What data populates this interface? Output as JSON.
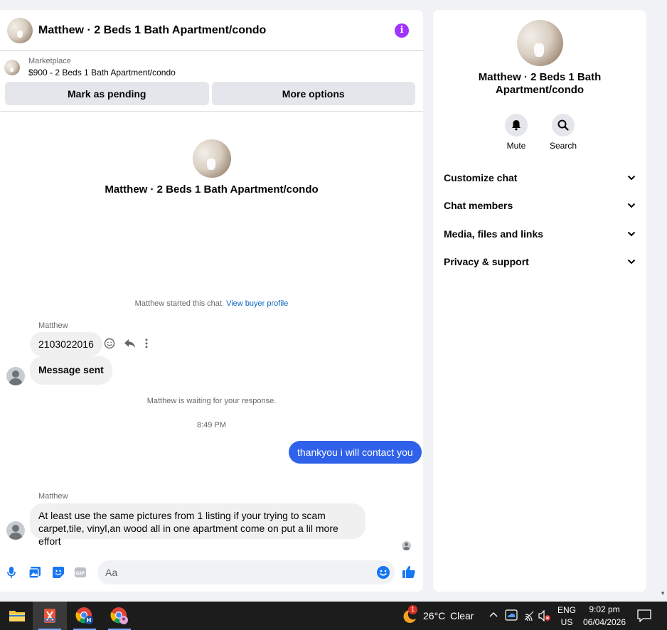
{
  "header": {
    "title": "Matthew · 2 Beds 1 Bath Apartment/condo",
    "info_icon": "info-icon"
  },
  "marketplace": {
    "label": "Marketplace",
    "listing": "$900 - 2 Beds 1 Bath Apartment/condo"
  },
  "actions": {
    "mark_pending": "Mark as pending",
    "more_options": "More options"
  },
  "profile": {
    "name": "Matthew · 2 Beds 1 Bath Apartment/condo"
  },
  "system": {
    "started_prefix": "Matthew started this chat.",
    "view_profile": "View buyer profile",
    "waiting": "Matthew is waiting for your response.",
    "timestamp": "8:49 PM"
  },
  "messages": {
    "sender1": "Matthew",
    "msg1": "2103022016",
    "msg2": "Message sent",
    "outgoing": "thankyou i will contact you",
    "sender2": "Matthew",
    "msg3_line1": "At least use the same pictures from 1 listing if your trying to scam",
    "msg3_line2": "carpet,tile, vinyl,an wood all in one apartment come on put a lil more effort"
  },
  "composer": {
    "placeholder": "Aa"
  },
  "info_panel": {
    "name_line1": "Matthew · 2 Beds 1 Bath",
    "name_line2": "Apartment/condo",
    "mute": "Mute",
    "search": "Search",
    "sections": [
      "Customize chat",
      "Chat members",
      "Media, files and links",
      "Privacy & support"
    ]
  },
  "taskbar": {
    "weather_temp": "26°C",
    "weather_cond": "Clear",
    "weather_badge": "1",
    "lang": "ENG",
    "region": "US",
    "time": "9:02 pm",
    "date": "06/04/2026"
  },
  "colors": {
    "accent_blue": "#2f61ea",
    "info_purple": "#a033ff",
    "link_blue": "#0a66c2"
  }
}
